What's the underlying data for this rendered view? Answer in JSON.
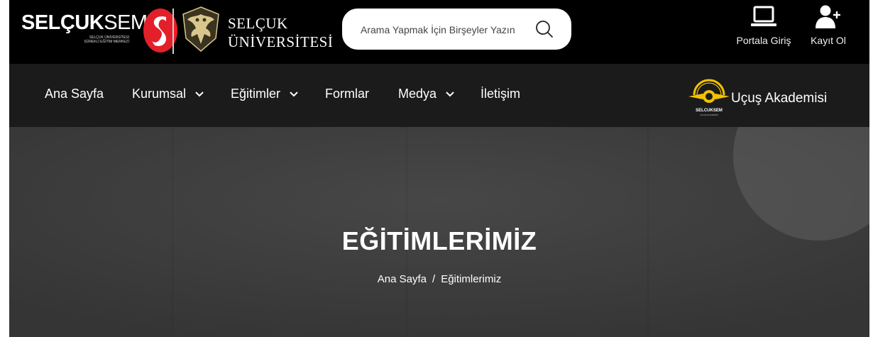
{
  "header": {
    "brand": {
      "bold": "SELÇUK",
      "thin": "SEM",
      "sub_line1": "SELÇUK ÜNİVERSİTESİ",
      "sub_line2": "SÜREKLİ EĞİTİM MERKEZİ"
    },
    "university": {
      "line1": "SELÇUK",
      "line2": "ÜNİVERSİTESİ"
    },
    "search": {
      "placeholder": "Arama Yapmak İçin Birşeyler Yazın",
      "icon": "search-icon"
    },
    "portal": {
      "label": "Portala Giriş",
      "icon": "laptop-icon"
    },
    "register": {
      "label": "Kayıt Ol",
      "icon": "user-plus-icon"
    }
  },
  "nav": {
    "items": [
      {
        "label": "Ana Sayfa",
        "dropdown": false
      },
      {
        "label": "Kurumsal",
        "dropdown": true
      },
      {
        "label": "Eğitimler",
        "dropdown": true
      },
      {
        "label": "Formlar",
        "dropdown": false
      },
      {
        "label": "Medya",
        "dropdown": true
      },
      {
        "label": "İletişim",
        "dropdown": false
      }
    ],
    "academy": {
      "label": "Uçuş Akademisi",
      "logo_text": "SELCUKSEM",
      "logo_sub": "UÇUŞ AKADEMİSİ"
    }
  },
  "hero": {
    "title": "EĞİTİMLERİMİZ",
    "breadcrumb": [
      "Ana Sayfa",
      "Eğitimlerimiz"
    ],
    "separator": "/"
  },
  "colors": {
    "topbar": "#000000",
    "navbar": "#1b1b1b",
    "hero": "#3e3e3e",
    "brand_red": "#e3202a",
    "academy_gold": "#f2c200"
  }
}
